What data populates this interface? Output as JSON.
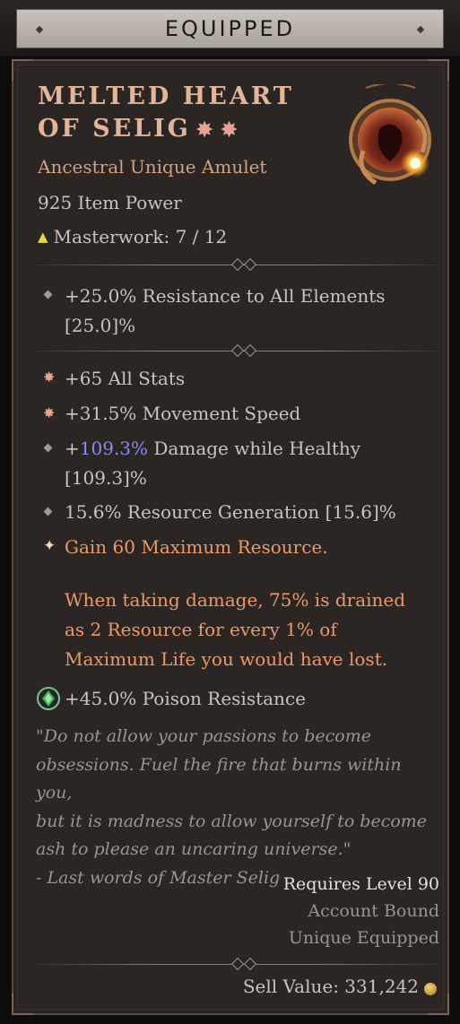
{
  "header": {
    "title": "EQUIPPED"
  },
  "item": {
    "name_line1": "Melted Heart",
    "name_line2": "of Selig",
    "type": "Ancestral Unique Amulet",
    "item_power": "925 Item Power",
    "masterwork": "Masterwork: 7 / 12"
  },
  "implicit": {
    "line1": "+25.0% Resistance to All Elements",
    "line2": "[25.0]%"
  },
  "affixes": [
    {
      "text": "+65 All Stats",
      "icon": "greater-affix-icon"
    },
    {
      "text": "+31.5% Movement Speed",
      "icon": "greater-affix-icon"
    },
    {
      "prefix": "+",
      "value": "109.3%",
      "suffix": " Damage while Healthy",
      "line2": "[109.3]%",
      "icon": "diamond-bullet-icon"
    },
    {
      "text": "15.6% Resource Generation [15.6]%",
      "icon": "diamond-bullet-icon"
    }
  ],
  "unique_power": {
    "line1": "Gain 60 Maximum Resource.",
    "line2": "When taking damage, 75% is drained",
    "line3": "as 2 Resource for every 1% of",
    "line4": "Maximum Life you would have lost."
  },
  "socket": {
    "text": "+45.0% Poison Resistance",
    "icon": "poison-gem-icon"
  },
  "lore": {
    "line1": "\"Do not allow your passions to become",
    "line2": "obsessions. Fuel the fire that burns within you,",
    "line3": "but it is madness to allow yourself to become",
    "line4": "ash to please an uncaring universe.\"",
    "line5": "- Last words of Master Selig"
  },
  "requirements": {
    "level": "Requires Level 90",
    "bound": "Account Bound",
    "unique": "Unique Equipped"
  },
  "sell": {
    "label": "Sell Value: 331,242"
  },
  "colors": {
    "title": "#e2b49a",
    "unique_text": "#ea9a6c",
    "highlight_value": "#8a8cf0",
    "masterwork_triangle": "#e8d54a"
  }
}
